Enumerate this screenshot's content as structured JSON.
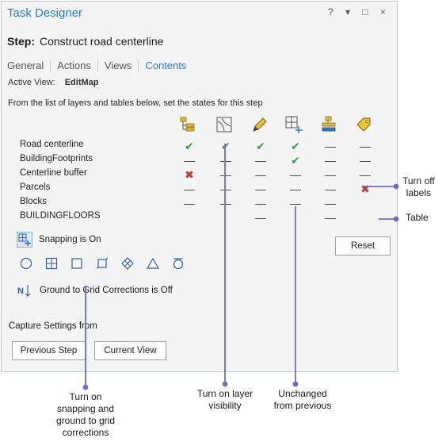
{
  "window": {
    "title": "Task Designer",
    "buttons": [
      "?",
      "▾",
      "□",
      "×"
    ]
  },
  "step": {
    "label": "Step:",
    "name": "Construct road centerline"
  },
  "tabs": [
    "General",
    "Actions",
    "Views",
    "Contents"
  ],
  "active_tab": "Contents",
  "active_view": {
    "label": "Active View:",
    "value": "EditMap"
  },
  "instructions": "From the list of layers and tables below, set the states for this step",
  "columns": [
    {
      "icon": "layer-selectable-icon"
    },
    {
      "icon": "visibility-icon"
    },
    {
      "icon": "editable-pencil-icon"
    },
    {
      "icon": "snapping-icon"
    },
    {
      "icon": "layer-stack-icon"
    },
    {
      "icon": "label-tag-icon"
    }
  ],
  "rows": [
    {
      "label": "Road centerline",
      "states": [
        "check",
        "check",
        "check",
        "check",
        "dash",
        "dash"
      ]
    },
    {
      "label": "BuildingFootprints",
      "states": [
        "dash",
        "dash",
        "dash",
        "check",
        "dash",
        "dash"
      ]
    },
    {
      "label": "Centerline buffer",
      "states": [
        "x",
        "dash",
        "dash",
        "dash",
        "dash",
        "dash"
      ]
    },
    {
      "label": "Parcels",
      "states": [
        "dash",
        "dash",
        "dash",
        "dash",
        "dash",
        "x"
      ]
    },
    {
      "label": "Blocks",
      "states": [
        "dash",
        "dash",
        "dash",
        "dash",
        "dash",
        ""
      ]
    },
    {
      "label": "BUILDINGFLOORS",
      "states": [
        "",
        "",
        "dash",
        "",
        "dash",
        ""
      ]
    }
  ],
  "snapping": {
    "label": "Snapping is On"
  },
  "snap_tools": [
    "point-snap-icon",
    "vertex-snap-icon",
    "edge-snap-icon",
    "end-snap-icon",
    "intersection-snap-icon",
    "midpoint-snap-icon",
    "tangent-snap-icon"
  ],
  "ground_to_grid": {
    "label": "Ground to Grid Corrections is Off"
  },
  "reset_label": "Reset",
  "capture": {
    "label": "Capture Settings from",
    "previous_label": "Previous Step",
    "current_label": "Current View"
  },
  "callouts": {
    "turn_off_labels": [
      "Turn off",
      "labels"
    ],
    "table": [
      "Table"
    ],
    "snapping_grid": [
      "Turn on",
      "snapping and",
      "ground to grid",
      "corrections"
    ],
    "layer_visibility": [
      "Turn on layer",
      "visibility"
    ],
    "unchanged": [
      "Unchanged",
      "from previous"
    ]
  },
  "colors": {
    "accent": "#2e7bbf",
    "check": "#3d9a3d",
    "x": "#c0392b",
    "callout_line": "#6c6cd0"
  }
}
